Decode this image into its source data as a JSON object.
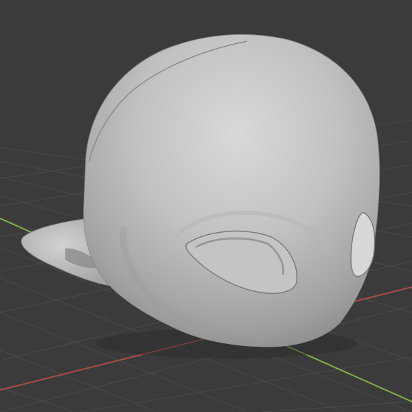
{
  "viewport": {
    "background_color": "#3b3b3b",
    "grid_color": "#4a4a4a",
    "x_axis_color": "#b34a4a",
    "y_axis_color": "#7fb34a",
    "model_color": "#a8a8a8"
  }
}
